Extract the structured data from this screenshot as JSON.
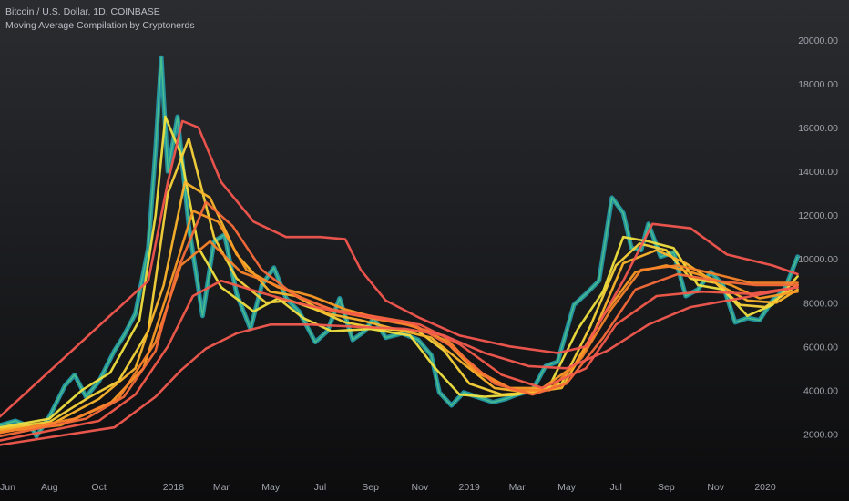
{
  "legend": {
    "symbol_line": "Bitcoin / U.S. Dollar, 1D, COINBASE",
    "indicator_line": "Moving Average Compilation by Cryptonerds"
  },
  "chart_data": {
    "type": "line",
    "title": "",
    "xlabel": "",
    "ylabel": "",
    "ylim": [
      600,
      21000
    ],
    "y_ticks": [
      2000,
      4000,
      6000,
      8000,
      10000,
      12000,
      14000,
      16000,
      18000,
      20000
    ],
    "y_tick_labels": [
      "2000.00",
      "4000.00",
      "6000.00",
      "8000.00",
      "10000.00",
      "12000.00",
      "14000.00",
      "16000.00",
      "18000.00",
      "20000.00"
    ],
    "x_range": [
      "2017-06-01",
      "2020-02-15"
    ],
    "x_ticks": [
      {
        "date": "2017-06-01",
        "label": "Jun"
      },
      {
        "date": "2017-08-01",
        "label": "Aug"
      },
      {
        "date": "2017-10-01",
        "label": "Oct"
      },
      {
        "date": "2018-01-01",
        "label": "2018"
      },
      {
        "date": "2018-03-01",
        "label": "Mar"
      },
      {
        "date": "2018-05-01",
        "label": "May"
      },
      {
        "date": "2018-07-01",
        "label": "Jul"
      },
      {
        "date": "2018-09-01",
        "label": "Sep"
      },
      {
        "date": "2018-11-01",
        "label": "Nov"
      },
      {
        "date": "2019-01-01",
        "label": "2019"
      },
      {
        "date": "2019-03-01",
        "label": "Mar"
      },
      {
        "date": "2019-05-01",
        "label": "May"
      },
      {
        "date": "2019-07-01",
        "label": "Jul"
      },
      {
        "date": "2019-09-01",
        "label": "Sep"
      },
      {
        "date": "2019-11-01",
        "label": "Nov"
      },
      {
        "date": "2020-01-01",
        "label": "2020"
      }
    ],
    "price_series": {
      "name": "",
      "color": "#26a7b5",
      "x": [
        "2017-06-01",
        "2017-06-20",
        "2017-07-10",
        "2017-07-16",
        "2017-08-01",
        "2017-08-20",
        "2017-09-01",
        "2017-09-15",
        "2017-10-01",
        "2017-10-20",
        "2017-11-01",
        "2017-11-15",
        "2017-12-01",
        "2017-12-10",
        "2017-12-17",
        "2017-12-25",
        "2018-01-06",
        "2018-01-20",
        "2018-02-06",
        "2018-02-20",
        "2018-03-05",
        "2018-03-20",
        "2018-04-06",
        "2018-04-20",
        "2018-05-05",
        "2018-05-20",
        "2018-06-05",
        "2018-06-25",
        "2018-07-10",
        "2018-07-25",
        "2018-08-10",
        "2018-08-25",
        "2018-09-05",
        "2018-09-20",
        "2018-10-10",
        "2018-10-30",
        "2018-11-15",
        "2018-11-25",
        "2018-12-10",
        "2018-12-25",
        "2019-01-10",
        "2019-01-30",
        "2019-02-15",
        "2019-03-01",
        "2019-03-20",
        "2019-04-05",
        "2019-04-20",
        "2019-05-10",
        "2019-05-25",
        "2019-06-10",
        "2019-06-26",
        "2019-07-10",
        "2019-07-20",
        "2019-08-01",
        "2019-08-10",
        "2019-08-25",
        "2019-09-10",
        "2019-09-25",
        "2019-10-10",
        "2019-10-26",
        "2019-11-10",
        "2019-11-25",
        "2019-12-10",
        "2019-12-25",
        "2020-01-10",
        "2020-01-25",
        "2020-02-10"
      ],
      "values": [
        2400,
        2600,
        2300,
        1900,
        2800,
        4200,
        4700,
        3700,
        4400,
        5800,
        6500,
        7500,
        10500,
        15000,
        19200,
        14000,
        16500,
        11500,
        7400,
        10800,
        11100,
        8400,
        6800,
        8800,
        9600,
        8200,
        7600,
        6200,
        6700,
        8200,
        6300,
        6700,
        7300,
        6400,
        6600,
        6300,
        5600,
        3900,
        3300,
        3900,
        3700,
        3450,
        3600,
        3800,
        4000,
        5100,
        5300,
        7900,
        8400,
        9000,
        12800,
        12100,
        10500,
        10400,
        11600,
        10100,
        10300,
        8300,
        8600,
        9400,
        8800,
        7100,
        7300,
        7200,
        8100,
        8600,
        10100
      ]
    },
    "moving_averages": [
      {
        "name": "",
        "color": "#f0e040",
        "x": [
          "2017-06-01",
          "2017-08-01",
          "2017-09-10",
          "2017-10-15",
          "2017-11-20",
          "2017-12-10",
          "2017-12-22",
          "2018-01-10",
          "2018-02-01",
          "2018-03-01",
          "2018-04-10",
          "2018-05-10",
          "2018-06-10",
          "2018-07-15",
          "2018-09-01",
          "2018-10-20",
          "2018-11-20",
          "2018-12-20",
          "2019-01-20",
          "2019-03-01",
          "2019-04-10",
          "2019-05-15",
          "2019-06-15",
          "2019-07-10",
          "2019-08-10",
          "2019-09-10",
          "2019-10-10",
          "2019-11-10",
          "2019-12-10",
          "2020-01-10",
          "2020-02-10"
        ],
        "values": [
          2300,
          2700,
          4000,
          4800,
          7200,
          12000,
          16500,
          14800,
          10500,
          8700,
          7600,
          8200,
          7300,
          6700,
          6800,
          6500,
          5000,
          3800,
          3700,
          3800,
          4200,
          6800,
          8500,
          11000,
          10800,
          10500,
          8800,
          8600,
          7400,
          7900,
          9200
        ]
      },
      {
        "name": "",
        "color": "#f7d33a",
        "x": [
          "2017-06-01",
          "2017-08-01",
          "2017-09-20",
          "2017-10-25",
          "2017-12-01",
          "2017-12-25",
          "2018-01-20",
          "2018-02-20",
          "2018-03-20",
          "2018-04-25",
          "2018-05-25",
          "2018-06-25",
          "2018-08-01",
          "2018-09-15",
          "2018-10-30",
          "2018-12-01",
          "2019-01-01",
          "2019-02-10",
          "2019-03-20",
          "2019-04-25",
          "2019-05-30",
          "2019-07-01",
          "2019-07-30",
          "2019-09-01",
          "2019-10-01",
          "2019-11-01",
          "2019-12-01",
          "2020-01-01",
          "2020-02-10"
        ],
        "values": [
          2250,
          2550,
          3700,
          4400,
          6700,
          13000,
          15500,
          11000,
          9100,
          8000,
          8100,
          7700,
          7100,
          6800,
          6700,
          5800,
          4300,
          3800,
          3900,
          4300,
          6900,
          9700,
          10700,
          10400,
          9100,
          8900,
          7900,
          7800,
          8800
        ]
      },
      {
        "name": "",
        "color": "#fbb52c",
        "x": [
          "2017-06-01",
          "2017-08-01",
          "2017-10-01",
          "2017-11-15",
          "2017-12-20",
          "2018-01-15",
          "2018-02-15",
          "2018-03-20",
          "2018-04-30",
          "2018-06-01",
          "2018-07-10",
          "2018-08-20",
          "2018-10-01",
          "2018-11-15",
          "2018-12-25",
          "2019-02-01",
          "2019-03-15",
          "2019-04-25",
          "2019-06-01",
          "2019-07-10",
          "2019-08-20",
          "2019-09-25",
          "2019-11-01",
          "2019-12-10",
          "2020-01-15",
          "2020-02-10"
        ],
        "values": [
          2200,
          2400,
          3600,
          5000,
          8800,
          13500,
          12800,
          10200,
          8500,
          8300,
          7500,
          7200,
          6800,
          6400,
          5200,
          4100,
          3900,
          4100,
          6400,
          9800,
          10400,
          9800,
          8900,
          8100,
          8000,
          8600
        ]
      },
      {
        "name": "",
        "color": "#fb9a26",
        "x": [
          "2017-06-01",
          "2017-08-15",
          "2017-10-15",
          "2017-11-25",
          "2017-12-25",
          "2018-01-25",
          "2018-02-25",
          "2018-04-01",
          "2018-05-10",
          "2018-06-20",
          "2018-08-01",
          "2018-09-10",
          "2018-10-20",
          "2018-12-01",
          "2019-01-10",
          "2019-02-20",
          "2019-04-01",
          "2019-05-10",
          "2019-06-15",
          "2019-07-25",
          "2019-09-01",
          "2019-10-10",
          "2019-11-20",
          "2019-12-25",
          "2020-02-10"
        ],
        "values": [
          2100,
          2400,
          3400,
          5000,
          8500,
          12200,
          11700,
          9500,
          8700,
          8300,
          7700,
          7300,
          7000,
          6300,
          4800,
          4100,
          4100,
          5100,
          7400,
          9400,
          9700,
          9300,
          8800,
          8200,
          8500
        ]
      },
      {
        "name": "",
        "color": "#f9832a",
        "x": [
          "2017-06-01",
          "2017-09-01",
          "2017-10-25",
          "2017-12-10",
          "2018-01-10",
          "2018-02-15",
          "2018-03-25",
          "2018-05-01",
          "2018-06-10",
          "2018-07-20",
          "2018-09-01",
          "2018-10-15",
          "2018-11-30",
          "2019-01-10",
          "2019-02-25",
          "2019-04-10",
          "2019-05-20",
          "2019-06-25",
          "2019-08-01",
          "2019-09-15",
          "2019-11-01",
          "2019-12-15",
          "2020-02-10"
        ],
        "values": [
          2050,
          2700,
          3600,
          6200,
          9700,
          10800,
          9400,
          8900,
          8200,
          7600,
          7300,
          7000,
          6500,
          4900,
          4000,
          4000,
          5500,
          7700,
          9500,
          9700,
          9300,
          8900,
          8900
        ]
      },
      {
        "name": "",
        "color": "#f76b3a",
        "x": [
          "2017-06-01",
          "2017-09-15",
          "2017-11-01",
          "2017-12-10",
          "2018-01-05",
          "2018-02-10",
          "2018-03-15",
          "2018-04-20",
          "2018-06-01",
          "2018-07-15",
          "2018-09-01",
          "2018-10-20",
          "2018-12-10",
          "2019-02-01",
          "2019-03-20",
          "2019-05-01",
          "2019-06-15",
          "2019-07-25",
          "2019-09-15",
          "2019-11-01",
          "2019-12-20",
          "2020-02-10"
        ],
        "values": [
          1900,
          2700,
          3700,
          5800,
          9400,
          12600,
          11500,
          9500,
          8300,
          7700,
          7400,
          7100,
          6000,
          4300,
          3800,
          4300,
          6400,
          8600,
          9300,
          9000,
          8800,
          8800
        ]
      },
      {
        "name": "",
        "color": "#f35a4a",
        "x": [
          "2017-06-01",
          "2017-10-01",
          "2017-11-15",
          "2017-12-25",
          "2018-01-25",
          "2018-03-01",
          "2018-04-15",
          "2018-06-01",
          "2018-07-20",
          "2018-09-10",
          "2018-11-01",
          "2018-12-20",
          "2019-02-10",
          "2019-04-01",
          "2019-05-25",
          "2019-07-01",
          "2019-08-20",
          "2019-10-15",
          "2019-12-15",
          "2020-02-10"
        ],
        "values": [
          1700,
          2600,
          3800,
          6000,
          8300,
          9000,
          8500,
          8000,
          7600,
          7300,
          7000,
          6100,
          4700,
          4100,
          5000,
          7000,
          8300,
          8500,
          8400,
          8700
        ]
      },
      {
        "name": "",
        "color": "#f25a4f",
        "x": [
          "2017-06-01",
          "2017-10-20",
          "2017-12-10",
          "2018-01-10",
          "2018-02-10",
          "2018-03-20",
          "2018-05-01",
          "2018-06-20",
          "2018-08-15",
          "2018-10-15",
          "2018-12-01",
          "2019-01-20",
          "2019-03-15",
          "2019-05-01",
          "2019-06-20",
          "2019-08-10",
          "2019-10-01",
          "2019-12-01",
          "2020-02-10"
        ],
        "values": [
          1500,
          2300,
          3700,
          4900,
          5900,
          6600,
          7000,
          7000,
          6900,
          6800,
          6500,
          5700,
          5100,
          5000,
          5800,
          7000,
          7800,
          8200,
          8700
        ]
      },
      {
        "name": "",
        "color": "#f3564f",
        "x": [
          "2017-06-01",
          "2017-12-01",
          "2017-12-25",
          "2018-01-12",
          "2018-02-01",
          "2018-03-01",
          "2018-04-10",
          "2018-05-20",
          "2018-07-01",
          "2018-08-01",
          "2018-08-20",
          "2018-09-20",
          "2018-11-01",
          "2018-12-20",
          "2019-02-20",
          "2019-04-20",
          "2019-05-25",
          "2019-07-10",
          "2019-08-15",
          "2019-10-01",
          "2019-11-15",
          "2020-01-10",
          "2020-02-10"
        ],
        "values": [
          2800,
          9000,
          13500,
          16300,
          16000,
          13500,
          11700,
          11000,
          11000,
          10900,
          9500,
          8100,
          7300,
          6500,
          6000,
          5700,
          6000,
          9000,
          11600,
          11400,
          10200,
          9700,
          9300
        ]
      }
    ]
  }
}
